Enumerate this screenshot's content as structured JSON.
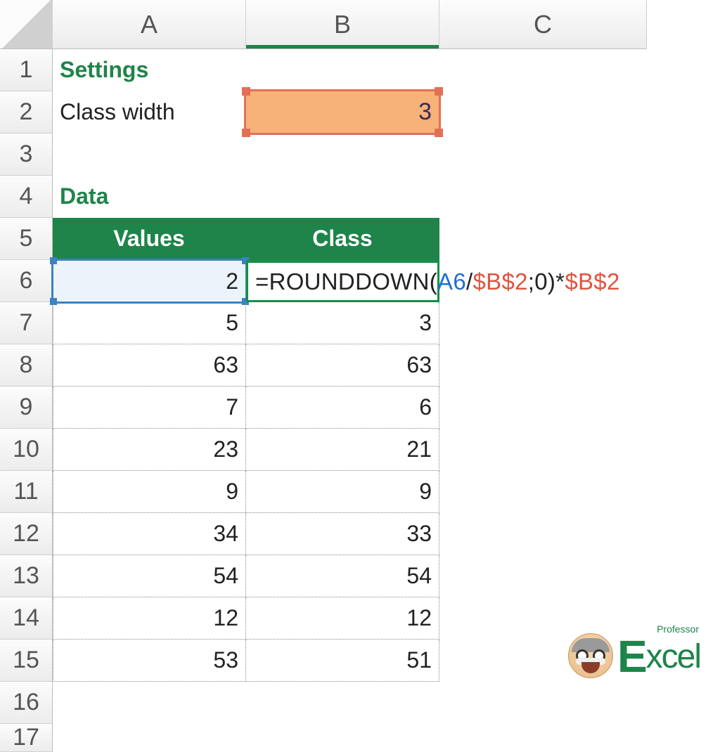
{
  "columns": [
    "A",
    "B",
    "C"
  ],
  "rows": [
    "1",
    "2",
    "3",
    "4",
    "5",
    "6",
    "7",
    "8",
    "9",
    "10",
    "11",
    "12",
    "13",
    "14",
    "15",
    "16",
    "17"
  ],
  "settings": {
    "heading": "Settings",
    "label": "Class width",
    "value": "3"
  },
  "data_heading": "Data",
  "table": {
    "headers": [
      "Values",
      "Class"
    ],
    "rows": [
      {
        "value": "2",
        "class_formula": {
          "prefix": "=ROUNDDOWN(",
          "a6": "A6",
          "mid1": "/",
          "b2a": "$B$2",
          "mid2": ";0)*",
          "b2b": "$B$2"
        }
      },
      {
        "value": "5",
        "class": "3"
      },
      {
        "value": "63",
        "class": "63"
      },
      {
        "value": "7",
        "class": "6"
      },
      {
        "value": "23",
        "class": "21"
      },
      {
        "value": "9",
        "class": "9"
      },
      {
        "value": "34",
        "class": "33"
      },
      {
        "value": "54",
        "class": "54"
      },
      {
        "value": "12",
        "class": "12"
      },
      {
        "value": "53",
        "class": "51"
      }
    ]
  },
  "logo": {
    "professor": "Professor",
    "excel": "xcel",
    "big_e": "E"
  }
}
